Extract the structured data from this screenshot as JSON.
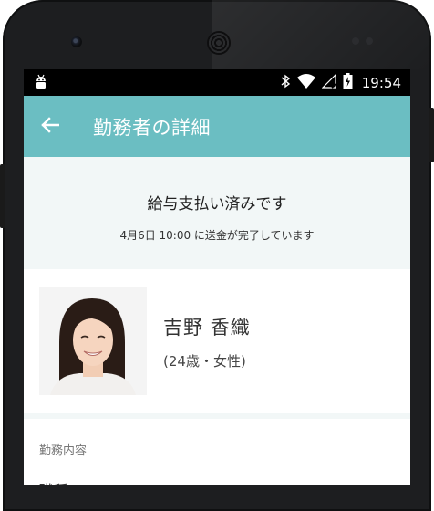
{
  "status_bar": {
    "time": "19:54"
  },
  "app_bar": {
    "title": "勤務者の詳細"
  },
  "payment_status": {
    "main": "給与支払い済みです",
    "detail": "4月6日  10:00 に送金が完了しています"
  },
  "worker": {
    "name": "吉野  香織",
    "age_gender": "(24歳・女性)"
  },
  "work_section": {
    "heading": "勤務内容",
    "job_label": "職種"
  },
  "icons": {
    "back": "arrow-left-icon",
    "debug": "android-debug-icon",
    "bluetooth": "bluetooth-icon",
    "wifi": "wifi-icon",
    "signal": "cell-signal-icon",
    "battery": "battery-charging-icon"
  },
  "colors": {
    "appbar": "#6bbec2",
    "status_bg": "#f2f7f7"
  }
}
